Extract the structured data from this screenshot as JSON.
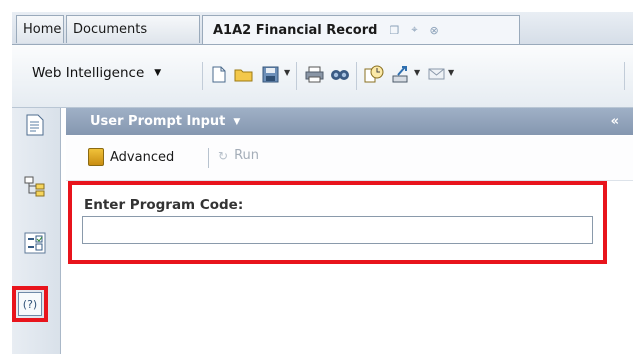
{
  "tabs": {
    "home": "Home",
    "documents": "Documents",
    "active": "A1A2 Financial Record",
    "active_icons": [
      "restore-icon",
      "pin-icon",
      "close-icon"
    ]
  },
  "toolbar": {
    "app_menu": "Web Intelligence",
    "icons": [
      "new-document-icon",
      "open-folder-icon",
      "save-icon",
      "print-icon",
      "find-icon",
      "history-icon",
      "export-icon",
      "email-icon"
    ]
  },
  "rail": {
    "icons": [
      "document-summary-icon",
      "navigation-map-icon",
      "input-controls-icon",
      "user-prompt-icon"
    ],
    "help_label": "(?)"
  },
  "panel": {
    "title": "User Prompt Input",
    "collapse": "«",
    "advanced_label": "Advanced",
    "run_label": "Run",
    "prompt_label": "Enter Program Code:",
    "prompt_value": "",
    "prompt_placeholder": ""
  },
  "colors": {
    "highlight": "#e8141c",
    "panel_header": "#8fa1b9"
  }
}
